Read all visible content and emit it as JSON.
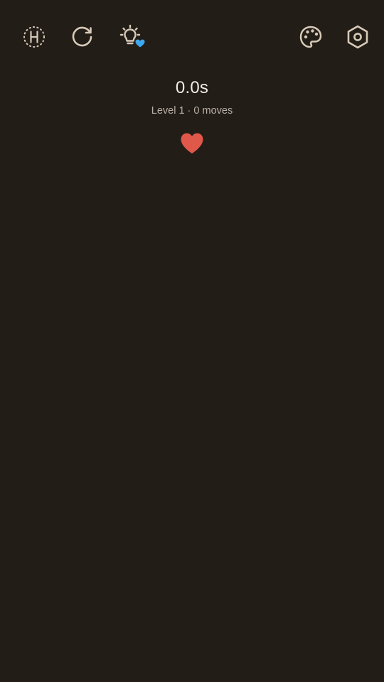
{
  "theme": {
    "background": "#231d18",
    "icon_color": "#d7cab8",
    "hint_badge_color": "#3ea8f0",
    "heart_color": "#e0584a"
  },
  "toolbar": {
    "left_icons": [
      "hexagon-h-icon",
      "restart-icon",
      "lightbulb-hint-icon"
    ],
    "right_icons": [
      "palette-icon",
      "settings-hex-icon"
    ]
  },
  "hud": {
    "timer": "0.0s",
    "status": "Level 1 · 0 moves",
    "lives_icon": "heart-icon"
  }
}
